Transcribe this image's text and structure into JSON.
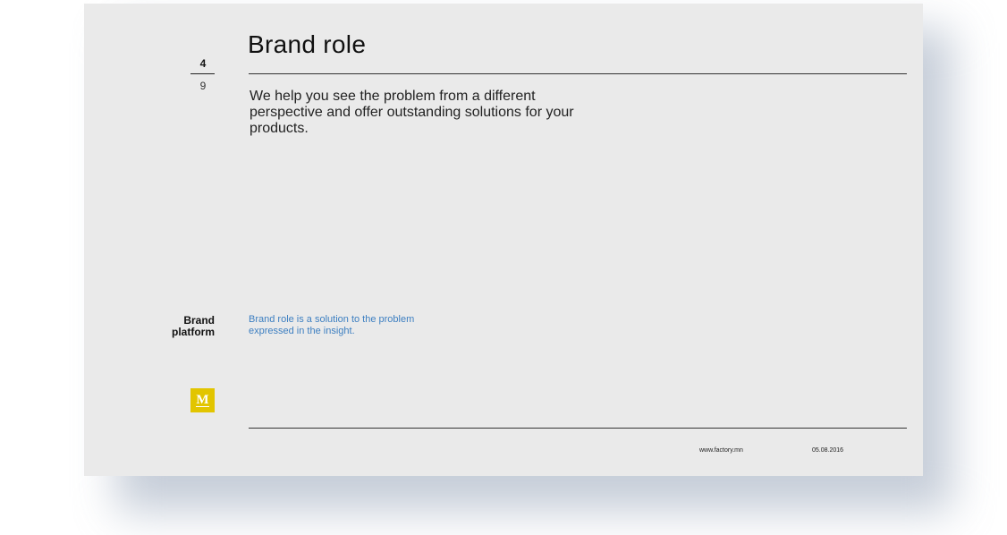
{
  "slide": {
    "page_current": "4",
    "page_total": "9",
    "title": "Brand role",
    "lead_text": "We help you see the problem from a different perspective and offer outstanding solutions for your products.",
    "section_label_line1": "Brand",
    "section_label_line2": "platform",
    "note_text": "Brand role is a solution to the problem expressed in the insight.",
    "logo_letter": "M",
    "logo_icon": "m-logo-icon",
    "footer_url": "www.factory.mn",
    "footer_date": "05.08.2016"
  },
  "colors": {
    "slide_background": "#eaeaea",
    "note_text": "#3d7fc1",
    "logo_background": "#e2c500"
  }
}
